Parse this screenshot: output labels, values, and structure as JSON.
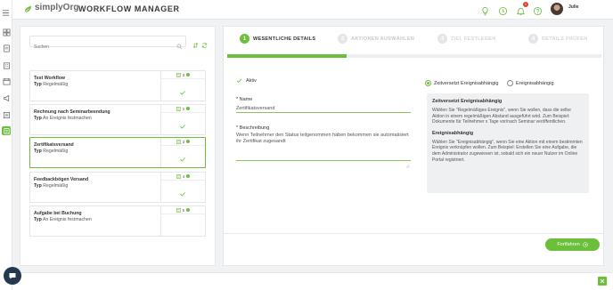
{
  "app": {
    "brand": "simplyOrg",
    "title": "WORKFLOW MANAGER",
    "user_name": "Julie",
    "notification_count": "1"
  },
  "colors": {
    "accent": "#6bbf3b",
    "navy": "#24384f"
  },
  "sidebar": {
    "items": [
      "dashboard-icon",
      "book-icon",
      "building-icon",
      "calendar-icon",
      "megaphone-icon",
      "list-icon",
      "workflow-icon"
    ]
  },
  "search": {
    "placeholder": "Suchen"
  },
  "workflows": [
    {
      "name": "Test Workflow",
      "type_label": "Typ",
      "type_value": "Regelmäßig",
      "count": "3"
    },
    {
      "name": "Rechnung nach Seminarbeendung",
      "type_label": "Typ",
      "type_value": "An Ereignis festmachen",
      "count": "2"
    },
    {
      "name": "Zertifikatsversand",
      "type_label": "Typ",
      "type_value": "Regelmäßig",
      "count": "3"
    },
    {
      "name": "Feedbackbögen Versand",
      "type_label": "Typ",
      "type_value": "Regelmäßig",
      "count": "4"
    },
    {
      "name": "Aufgabe bei Buchung",
      "type_label": "Typ",
      "type_value": "An Ereignis festmachen",
      "count": "5"
    }
  ],
  "steps": [
    {
      "num": "1",
      "label": "WESENTLICHE DETAILS"
    },
    {
      "num": "2",
      "label": "AKTIONEN AUSWÄHLEN"
    },
    {
      "num": "3",
      "label": "ZIEL FESTLEGEN"
    },
    {
      "num": "4",
      "label": "DETAILS PRÜFEN"
    }
  ],
  "progress": 0.32,
  "form": {
    "active_label": "Aktiv",
    "name_label": "* Name",
    "name_value": "Zertifikatsversand",
    "desc_label": "* Beschreibung",
    "desc_value": "Wenn Teilnehmer den Status teilgenommen haben bekommen sie automatisiert ihr Zertifikat zugesandt"
  },
  "radios": {
    "option1": "Zeitversetzt Ereignisabhängig",
    "option2": "Ereignisabhängig",
    "selected": "option1"
  },
  "info": {
    "h1": "Zeitversetzt Ereignisabhängig",
    "p1": "Wählen Sie \"Regelmäßiges Ereignis\", wenn Sie wollen, dass die selbe Aktion in einem regelmäßigen Abstand ausgeführt wird. Zum Beispiel: Dokumente für Teilnehmer x Tage vor/nach Seminar veröffentlichen.",
    "h2": "Ereignisabhängig",
    "p2": "Wählen Sie \"Ereignisabhängig\", wenn Sie eine Aktion mit einem bestimmten Ereignis verknüpfen wollen. Zum Beispiel: Erstellen Sie eine Aufgabe, die dem Administrator zugewiesen ist, sobald sich ein neuer Nutzer im Online Portal registriert."
  },
  "buttons": {
    "next": "Fortfahren"
  }
}
